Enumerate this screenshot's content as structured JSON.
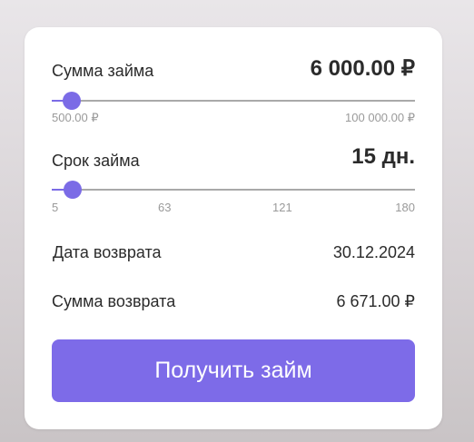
{
  "loan_amount": {
    "label": "Сумма займа",
    "value": "6 000.00 ₽",
    "min_label": "500.00 ₽",
    "max_label": "100 000.00 ₽",
    "slider_fraction": 0.055
  },
  "loan_term": {
    "label": "Срок займа",
    "value": "15 дн.",
    "ticks": [
      "5",
      "63",
      "121",
      "180"
    ],
    "slider_fraction": 0.057
  },
  "return_date": {
    "label": "Дата возврата",
    "value": "30.12.2024"
  },
  "return_amount": {
    "label": "Сумма возврата",
    "value": "6 671.00 ₽"
  },
  "cta": {
    "label": "Получить займ"
  },
  "colors": {
    "accent": "#7b6be6",
    "track": "#a9a9a9"
  }
}
